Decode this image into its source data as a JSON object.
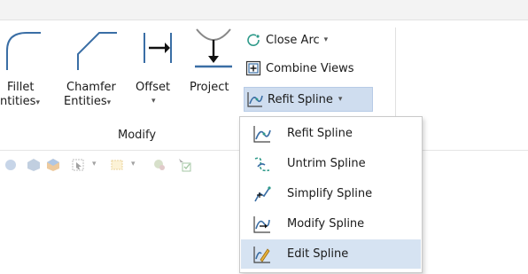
{
  "ribbon": {
    "fillet": {
      "line1": "Fillet",
      "line2": "ntities"
    },
    "chamfer": {
      "line1": "Chamfer",
      "line2": "Entities"
    },
    "offset": {
      "label": "Offset"
    },
    "project": {
      "label": "Project"
    },
    "close_arc": {
      "label": "Close Arc"
    },
    "combine_views": {
      "label": "Combine Views"
    },
    "refit_spline": {
      "label": "Refit Spline"
    },
    "group_label": "Modify"
  },
  "menu": {
    "items": [
      {
        "label": "Refit Spline",
        "icon": "refit-spline-icon"
      },
      {
        "label": "Untrim Spline",
        "icon": "untrim-spline-icon"
      },
      {
        "label": "Simplify Spline",
        "icon": "simplify-spline-icon"
      },
      {
        "label": "Modify Spline",
        "icon": "modify-spline-icon"
      },
      {
        "label": "Edit Spline",
        "icon": "edit-spline-icon"
      }
    ],
    "active_index": 4
  },
  "colors": {
    "highlight": "#cfddef",
    "menu_active": "#d6e3f2",
    "icon_blue": "#3a6ea5",
    "icon_teal": "#2f9a8a"
  }
}
